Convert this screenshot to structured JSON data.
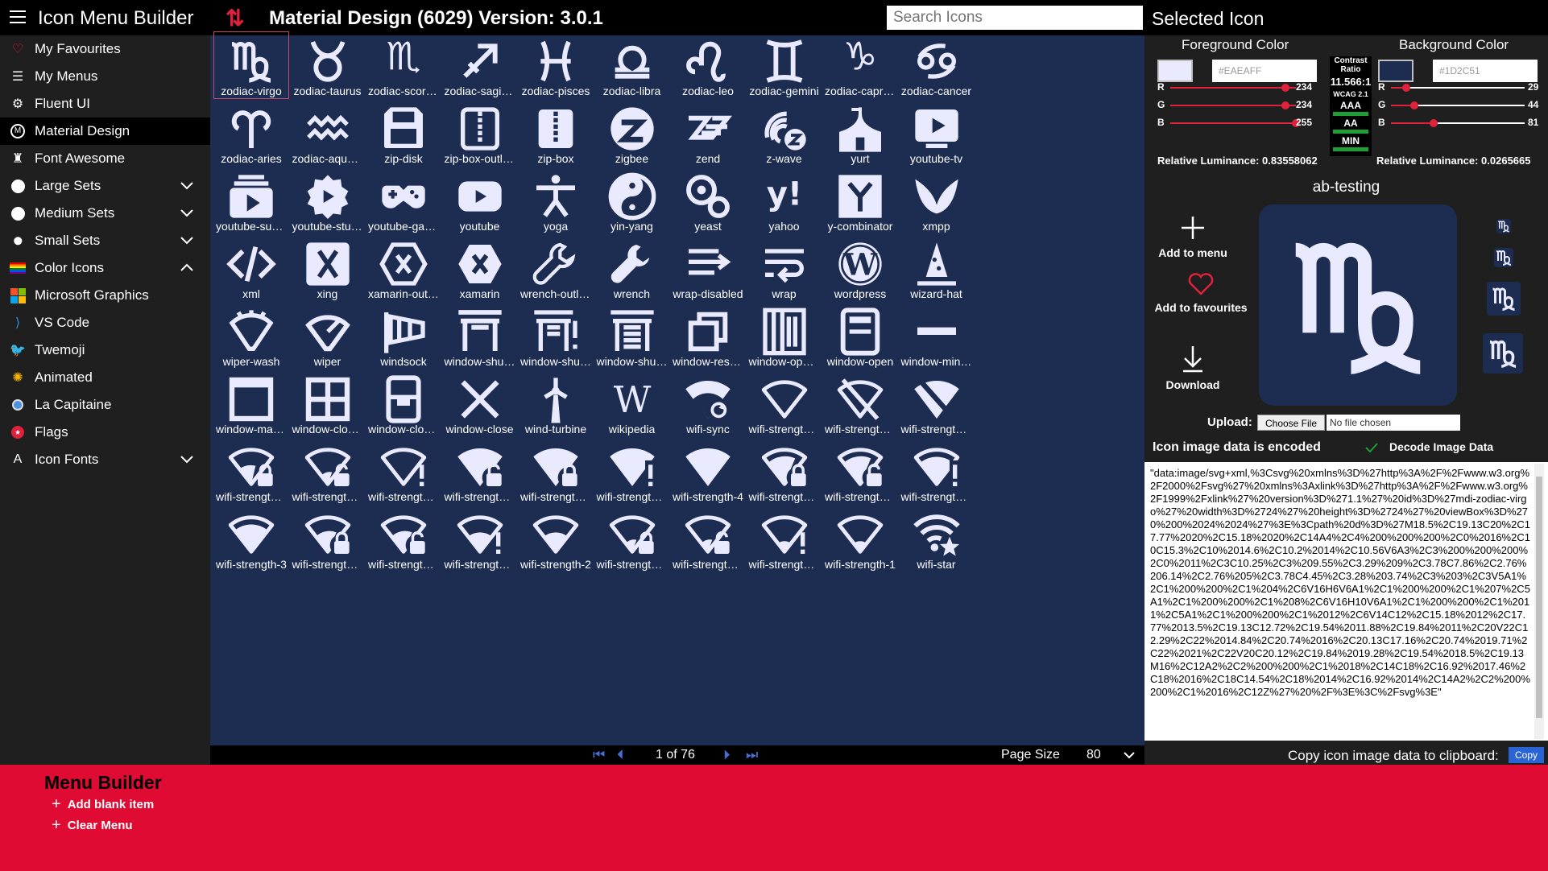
{
  "app": {
    "title": "Icon Menu Builder",
    "set_title": "Material Design (6029) Version: 3.0.1",
    "search_placeholder": "Search Icons"
  },
  "sidebar": {
    "items": [
      {
        "label": "My Favourites",
        "icon": "heart-icon"
      },
      {
        "label": "My Menus",
        "icon": "list-icon"
      },
      {
        "label": "Fluent UI",
        "icon": "fluent-icon"
      },
      {
        "label": "Material Design",
        "icon": "material-icon"
      },
      {
        "label": "Font Awesome",
        "icon": "font-awesome-icon"
      },
      {
        "label": "Large Sets",
        "icon": "circle-icon"
      },
      {
        "label": "Medium Sets",
        "icon": "circle-icon"
      },
      {
        "label": "Small Sets",
        "icon": "circle-icon"
      },
      {
        "label": "Color Icons",
        "icon": "rainbow-icon"
      },
      {
        "label": "Microsoft Graphics",
        "icon": "microsoft-icon"
      },
      {
        "label": "VS Code",
        "icon": "vscode-icon"
      },
      {
        "label": "Twemoji",
        "icon": "bird-icon"
      },
      {
        "label": "Animated",
        "icon": "sun-icon"
      },
      {
        "label": "La Capitaine",
        "icon": "drop-icon"
      },
      {
        "label": "Flags",
        "icon": "flag-icon"
      },
      {
        "label": "Icon Fonts",
        "icon": "font-icon"
      }
    ]
  },
  "icons": [
    "zodiac-virgo",
    "zodiac-taurus",
    "zodiac-scorpio",
    "zodiac-sagitta...",
    "zodiac-pisces",
    "zodiac-libra",
    "zodiac-leo",
    "zodiac-gemini",
    "zodiac-capric...",
    "zodiac-cancer",
    "zodiac-aries",
    "zodiac-aquarius",
    "zip-disk",
    "zip-box-outline",
    "zip-box",
    "zigbee",
    "zend",
    "z-wave",
    "yurt",
    "youtube-tv",
    "youtube-subs...",
    "youtube-studio",
    "youtube-gami...",
    "youtube",
    "yoga",
    "yin-yang",
    "yeast",
    "yahoo",
    "y-combinator",
    "xmpp",
    "xml",
    "xing",
    "xamarin-outline",
    "xamarin",
    "wrench-outline",
    "wrench",
    "wrap-disabled",
    "wrap",
    "wordpress",
    "wizard-hat",
    "wiper-wash",
    "wiper",
    "windsock",
    "window-shutt...",
    "window-shutt...",
    "window-shutter",
    "window-restore",
    "window-open...",
    "window-open",
    "window-mini...",
    "window-maxi...",
    "window-close...",
    "window-closed",
    "window-close",
    "wind-turbine",
    "wikipedia",
    "wifi-sync",
    "wifi-strength-...",
    "wifi-strength-...",
    "wifi-strength-...",
    "wifi-strength-l...",
    "wifi-strength-l...",
    "wifi-strength-...",
    "wifi-strength-...",
    "wifi-strength-...",
    "wifi-strength-...",
    "wifi-strength-4",
    "wifi-strength-...",
    "wifi-strength-...",
    "wifi-strength-...",
    "wifi-strength-3",
    "wifi-strength-...",
    "wifi-strength-...",
    "wifi-strength-...",
    "wifi-strength-2",
    "wifi-strength-...",
    "wifi-strength-...",
    "wifi-strength-...",
    "wifi-strength-1",
    "wifi-star"
  ],
  "pager": {
    "info": "1 of 76",
    "page_size_label": "Page Size",
    "page_size": "80"
  },
  "panel": {
    "title": "Selected Icon",
    "foreground": {
      "title": "Foreground Color",
      "hex": "#EAEAFF",
      "r": 234,
      "g": 234,
      "b": 255,
      "luminance_label": "Relative Luminance: 0.83558062"
    },
    "background": {
      "title": "Background Color",
      "hex": "#1D2C51",
      "r": 29,
      "g": 44,
      "b": 81,
      "luminance_label": "Relative Luminance: 0.0265665"
    },
    "contrast": {
      "title": "Contrast Ratio",
      "ratio": "11.566:1",
      "wcag": "WCAG 2.1",
      "levels": [
        "AAA",
        "AA",
        "MIN"
      ]
    },
    "icon_name": "ab-testing",
    "add_to_menu": "Add to menu",
    "add_to_favourites": "Add to favourites",
    "download": "Download",
    "upload_label": "Upload:",
    "choose_file": "Choose File",
    "file_status": "No file chosen",
    "encoded_label": "Icon image data is encoded",
    "decode_label": "Decode Image Data",
    "image_data": "\"data:image/svg+xml,%3Csvg%20xmlns%3D%27http%3A%2F%2Fwww.w3.org%2F2000%2Fsvg%27%20xmlns%3Axlink%3D%27http%3A%2F%2Fwww.w3.org%2F1999%2Fxlink%27%20version%3D%271.1%27%20id%3D%27mdi-zodiac-virgo%27%20width%3D%2724%27%20height%3D%2724%27%20viewBox%3D%270%200%2024%2024%27%3E%3Cpath%20d%3D%27M18.5%2C19.13C20%2C17.77%2020%2C15.18%2020%2C14A4%2C4%200%200%200%2C0%2016%2C10C15.3%2C10%2014.6%2C10.2%2014%2C10.56V6A3%2C3%200%200%200%2C0%2011%2C3C10.25%2C3%209.55%2C3.29%209%2C3.78C7.86%2C2.76%206.14%2C2.76%205%2C3.78C4.45%2C3.28%203.74%2C3%203%2C3V5A1%2C1%200%200%2C1%204%2C6V16H6V6A1%2C1%200%200%2C1%207%2C5A1%2C1%200%200%2C1%208%2C6V16H10V6A1%2C1%200%200%2C1%2011%2C5A1%2C1%200%200%2C1%2012%2C6V14C12%2C15.18%2012%2C17.77%2013.5%2C19.13C12.72%2C19.54%2011.88%2C19.84%2011%2C20V22C12.29%2C22%2014.84%2C20.74%2016%2C20.13C17.16%2C20.74%2019.71%2C22%2021%2C22V20C20.12%2C19.84%2019.28%2C19.54%2018.5%2C19.13M16%2C12A2%2C2%200%200%2C1%2018%2C14C18%2C16.92%2017.46%2C18%2016%2C18C14.54%2C18%2014%2C16.92%2014%2C14A2%2C2%200%200%2C1%2016%2C12Z%27%20%2F%3E%3C%2Fsvg%3E\"",
    "copy_label": "Copy icon image data to clipboard:",
    "copy_button": "Copy"
  },
  "builder": {
    "title": "Menu Builder",
    "add_blank": "Add blank item",
    "clear_menu": "Clear Menu"
  },
  "colors": {
    "grid_bg": "#1D2C51",
    "icon_fg": "#EAEAFF",
    "accent_red": "#E00B33",
    "panel_bg": "#1F1F1F"
  }
}
